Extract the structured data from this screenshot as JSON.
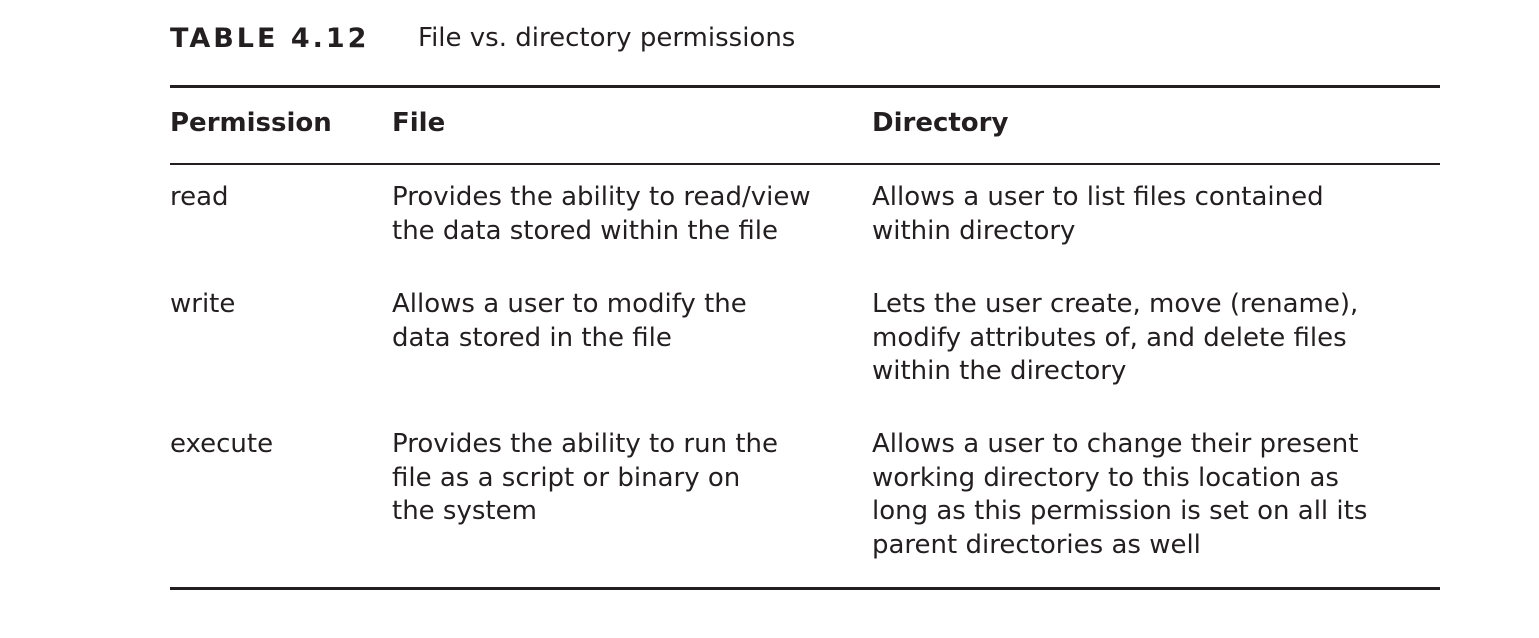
{
  "table": {
    "label": "TABLE 4.12",
    "title": "File vs. directory permissions",
    "headers": {
      "permission": "Permission",
      "file": "File",
      "directory": "Directory"
    },
    "rows": [
      {
        "permission": "read",
        "file": "Provides the ability to read/view\nthe data stored within the file",
        "directory": "Allows a user to list files contained\nwithin directory"
      },
      {
        "permission": "write",
        "file": "Allows a user to modify the\ndata stored in the file",
        "directory": "Lets the user create, move (rename),\nmodify attributes of, and delete files\nwithin the directory"
      },
      {
        "permission": "execute",
        "file": "Provides the ability to run the\nfile as a script or binary on\nthe system",
        "directory": "Allows a user to change their present\nworking directory to this location as\nlong as this permission is set on all its\nparent directories as well"
      }
    ]
  }
}
